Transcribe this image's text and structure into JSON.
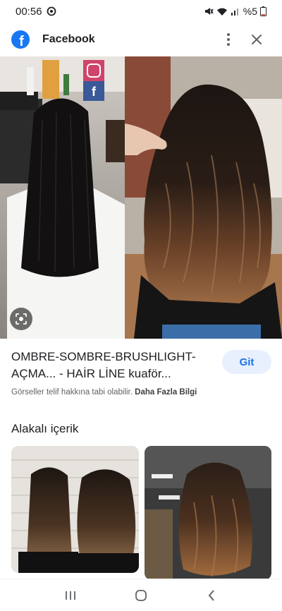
{
  "status_bar": {
    "time": "00:56",
    "battery": "%5"
  },
  "header": {
    "title": "Facebook",
    "logo_letter": "f"
  },
  "result": {
    "title_line1": "OMBRE-SOMBRE-BRUSHLIGHT-",
    "title_line2": "AÇMA... - HAİR LİNE kuaför...",
    "visit_label": "Git",
    "copyright_text": "Görseller telif hakkına tabi olabilir.",
    "more_info_label": "Daha Fazla Bilgi"
  },
  "related": {
    "heading": "Alakalı içerik"
  },
  "colors": {
    "brand": "#1877f2",
    "accent": "#1a73e8",
    "button_bg": "#e8f0fe"
  }
}
